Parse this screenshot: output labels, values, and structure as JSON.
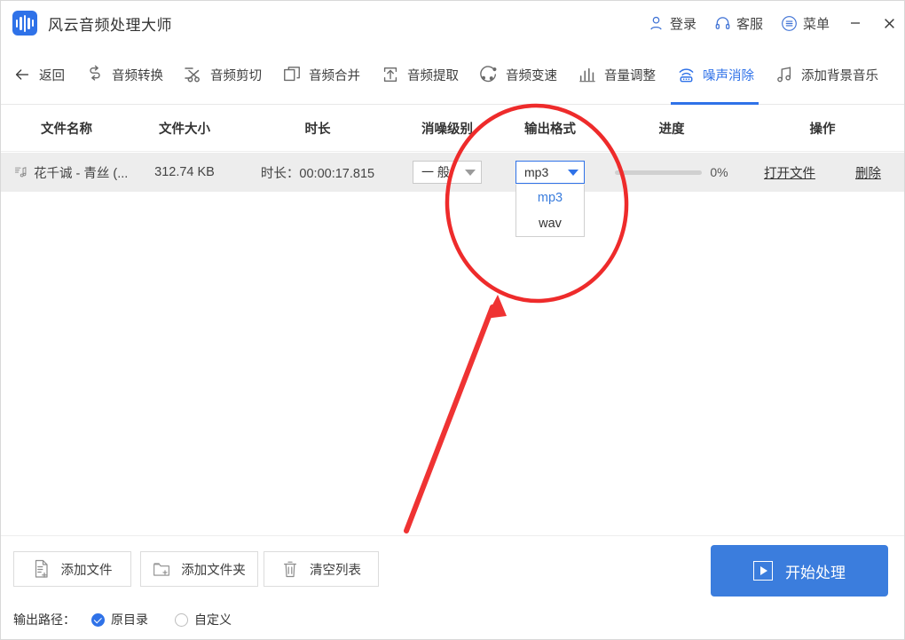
{
  "window": {
    "app_title": "风云音频处理大师",
    "logo_icon": "audio-waveform-icon",
    "login_label": "登录",
    "login_icon": "user-icon",
    "support_label": "客服",
    "support_icon": "headset-icon",
    "menu_label": "菜单",
    "menu_icon": "list-menu-icon",
    "minimize_icon": "minimize-icon",
    "close_icon": "close-icon",
    "accent_color": "#2f72e8"
  },
  "navbar": {
    "items": [
      {
        "label": "返回",
        "icon": "arrow-left-icon",
        "active": false
      },
      {
        "label": "音频转换",
        "icon": "convert-arrows-icon",
        "active": false
      },
      {
        "label": "音频剪切",
        "icon": "scissors-icon",
        "active": false
      },
      {
        "label": "音频合并",
        "icon": "merge-squares-icon",
        "active": false
      },
      {
        "label": "音频提取",
        "icon": "extract-upload-icon",
        "active": false
      },
      {
        "label": "音频变速",
        "icon": "speed-dots-icon",
        "active": false
      },
      {
        "label": "音量调整",
        "icon": "bars-volume-icon",
        "active": false
      },
      {
        "label": "噪声消除",
        "icon": "noise-signal-icon",
        "active": true
      },
      {
        "label": "添加背景音乐",
        "icon": "music-note-icon",
        "active": false
      }
    ]
  },
  "table": {
    "headers": {
      "name": "文件名称",
      "size": "文件大小",
      "duration": "时长",
      "level": "消噪级别",
      "format": "输出格式",
      "progress": "进度",
      "action": "操作"
    },
    "rows": [
      {
        "file_icon": "music-note-file-icon",
        "name": "花千诚 - 青丝 (...",
        "size": "312.74 KB",
        "duration": "时长：00:00:17.815",
        "level_value": "一 般",
        "format_value": "mp3",
        "progress_value": "0%",
        "progress_percent": 0,
        "open_label": "打开文件",
        "delete_label": "删除"
      }
    ]
  },
  "format_dropdown": {
    "open": true,
    "selected": "mp3",
    "options": [
      "mp3",
      "wav"
    ]
  },
  "bottom": {
    "add_file_label": "添加文件",
    "add_file_icon": "file-plus-icon",
    "add_folder_label": "添加文件夹",
    "add_folder_icon": "folder-plus-icon",
    "clear_list_label": "清空列表",
    "clear_list_icon": "trash-icon",
    "start_label": "开始处理",
    "start_icon": "play-icon",
    "output_path_label": "输出路径：",
    "radio_original": "原目录",
    "radio_custom": "自定义",
    "radio_selected": "原目录"
  },
  "annotations": {
    "ellipse_color": "#ee2b2b",
    "arrow_color": "#ef3333",
    "ellipse_target": "输出格式",
    "arrow_points_to": "format-dropdown"
  }
}
